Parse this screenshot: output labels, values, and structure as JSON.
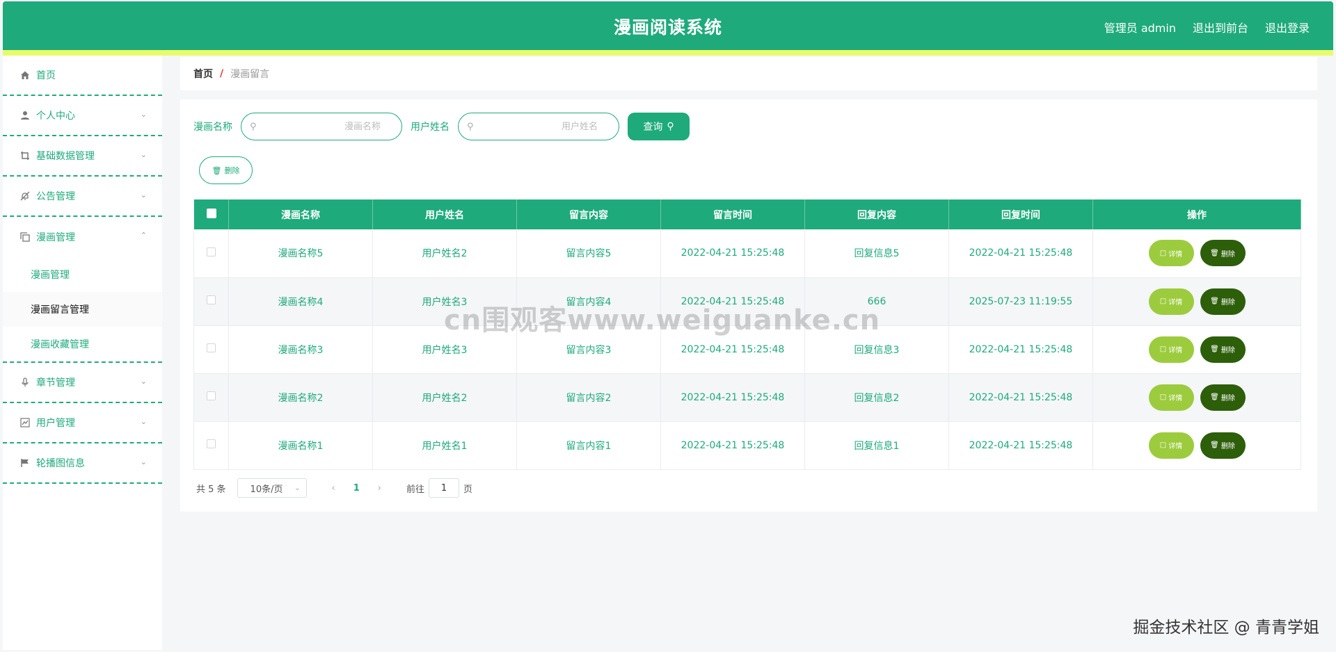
{
  "header": {
    "title": "漫画阅读系统",
    "user_label": "管理员 admin",
    "to_front": "退出到前台",
    "logout": "退出登录",
    "accent": "#1eaa7b",
    "strip_color": "#e9fb6a"
  },
  "sidebar": {
    "items": [
      {
        "label": "首页",
        "icon": "home-icon"
      },
      {
        "label": "个人中心",
        "icon": "user-icon"
      },
      {
        "label": "基础数据管理",
        "icon": "crop-icon"
      },
      {
        "label": "公告管理",
        "icon": "bell-off-icon"
      },
      {
        "label": "漫画管理",
        "icon": "copy-icon"
      },
      {
        "label": "章节管理",
        "icon": "microphone-icon"
      },
      {
        "label": "用户管理",
        "icon": "chart-icon"
      },
      {
        "label": "轮播图信息",
        "icon": "flag-icon"
      }
    ],
    "sub": [
      "漫画管理",
      "漫画留言管理",
      "漫画收藏管理"
    ]
  },
  "breadcrumb": {
    "home": "首页",
    "sep": "/",
    "current": "漫画留言"
  },
  "search": {
    "label1": "漫画名称",
    "placeholder1": "漫画名称",
    "label2": "用户姓名",
    "placeholder2": "用户姓名",
    "query_label": "查询",
    "batch_delete_label": "删除"
  },
  "table": {
    "headers": [
      "漫画名称",
      "用户姓名",
      "留言内容",
      "留言时间",
      "回复内容",
      "回复时间",
      "操作"
    ],
    "rows": [
      {
        "comic": "漫画名称5",
        "user": "用户姓名2",
        "content": "留言内容5",
        "time": "2022-04-21 15:25:48",
        "reply": "回复信息5",
        "reply_time": "2022-04-21 15:25:48"
      },
      {
        "comic": "漫画名称4",
        "user": "用户姓名3",
        "content": "留言内容4",
        "time": "2022-04-21 15:25:48",
        "reply": "666",
        "reply_time": "2025-07-23 11:19:55"
      },
      {
        "comic": "漫画名称3",
        "user": "用户姓名3",
        "content": "留言内容3",
        "time": "2022-04-21 15:25:48",
        "reply": "回复信息3",
        "reply_time": "2022-04-21 15:25:48"
      },
      {
        "comic": "漫画名称2",
        "user": "用户姓名2",
        "content": "留言内容2",
        "time": "2022-04-21 15:25:48",
        "reply": "回复信息2",
        "reply_time": "2022-04-21 15:25:48"
      },
      {
        "comic": "漫画名称1",
        "user": "用户姓名1",
        "content": "留言内容1",
        "time": "2022-04-21 15:25:48",
        "reply": "回复信息1",
        "reply_time": "2022-04-21 15:25:48"
      }
    ],
    "detail_label": "详情",
    "delete_label": "删除"
  },
  "pagination": {
    "total": "共 5 条",
    "page_size": "10条/页",
    "current_page": "1",
    "goto_prefix": "前往",
    "goto_value": "1",
    "goto_suffix": "页"
  },
  "watermark": {
    "center": "cn围观客www.weiguanke.cn",
    "corner": "掘金技术社区 @ 青青学姐"
  }
}
